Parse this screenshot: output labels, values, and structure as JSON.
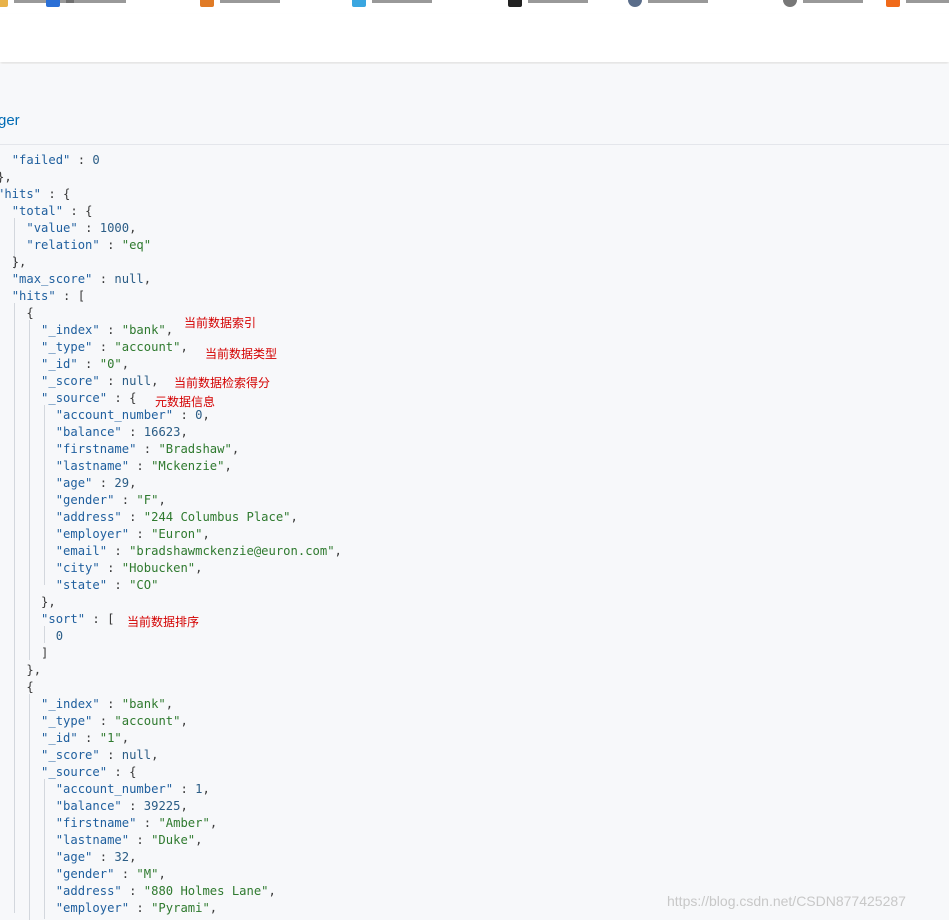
{
  "colors": {
    "key": "#1f5f9e",
    "string": "#2f7a2f",
    "number": "#2b5d86",
    "annotation": "#d40000",
    "link": "#006bb4",
    "panel_bg": "#f7f8fa"
  },
  "bookmarks": [
    {
      "icon": "bookmark-icon",
      "color": "#e8b24a"
    },
    {
      "icon": "edge-icon",
      "color": "#2a6fd6"
    },
    {
      "icon": "bookmark-icon",
      "color": "#e07b26"
    },
    {
      "icon": "bookmark-icon",
      "color": "#3aa6e0"
    },
    {
      "icon": "bookmark-icon",
      "color": "#222222"
    },
    {
      "icon": "globe-icon",
      "color": "#5a6d8a"
    },
    {
      "icon": "globe-icon",
      "color": "#777777"
    },
    {
      "icon": "bookmark-icon",
      "color": "#f06a1a"
    }
  ],
  "breadcrumb": "ger",
  "annotations": {
    "index": "当前数据索引",
    "type": "当前数据类型",
    "score": "当前数据检索得分",
    "source": "元数据信息",
    "sort": "当前数据排序"
  },
  "code_lines": [
    "  \"failed\" : 0",
    "},",
    "\"hits\" : {",
    "  \"total\" : {",
    "    \"value\" : 1000,",
    "    \"relation\" : \"eq\"",
    "  },",
    "  \"max_score\" : null,",
    "  \"hits\" : [",
    "    {",
    "      \"_index\" : \"bank\",",
    "      \"_type\" : \"account\",",
    "      \"_id\" : \"0\",",
    "      \"_score\" : null,",
    "      \"_source\" : {",
    "        \"account_number\" : 0,",
    "        \"balance\" : 16623,",
    "        \"firstname\" : \"Bradshaw\",",
    "        \"lastname\" : \"Mckenzie\",",
    "        \"age\" : 29,",
    "        \"gender\" : \"F\",",
    "        \"address\" : \"244 Columbus Place\",",
    "        \"employer\" : \"Euron\",",
    "        \"email\" : \"bradshawmckenzie@euron.com\",",
    "        \"city\" : \"Hobucken\",",
    "        \"state\" : \"CO\"",
    "      },",
    "      \"sort\" : [",
    "        0",
    "      ]",
    "    },",
    "    {",
    "      \"_index\" : \"bank\",",
    "      \"_type\" : \"account\",",
    "      \"_id\" : \"1\",",
    "      \"_score\" : null,",
    "      \"_source\" : {",
    "        \"account_number\" : 1,",
    "        \"balance\" : 39225,",
    "        \"firstname\" : \"Amber\",",
    "        \"lastname\" : \"Duke\",",
    "        \"age\" : 32,",
    "        \"gender\" : \"M\",",
    "        \"address\" : \"880 Holmes Lane\",",
    "        \"employer\" : \"Pyrami\","
  ],
  "watermark": "https://blog.csdn.net/CSDN877425287"
}
